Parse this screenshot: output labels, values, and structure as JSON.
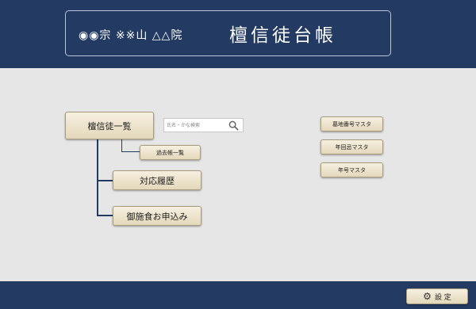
{
  "header": {
    "temple_name": "◉◉宗 ※※山 △△院",
    "app_title": "檀信徒台帳"
  },
  "main": {
    "danshinto_list_button": "檀信徒一覧",
    "search": {
      "placeholder": "氏名・かな検索",
      "value": ""
    },
    "deceased_list_button": "過去帳一覧",
    "history_button": "対応履歴",
    "offering_button": "御施食お申込み"
  },
  "masters": {
    "grave_master_button": "墓地番号マスタ",
    "memorial_master_button": "年回忌マスタ",
    "era_master_button": "年号マスタ"
  },
  "footer": {
    "settings_button": "設 定",
    "settings_icon": "gear-icon"
  },
  "colors": {
    "navy": "#233a62",
    "background": "#e6e6e6",
    "button": "#ebe2c9"
  }
}
